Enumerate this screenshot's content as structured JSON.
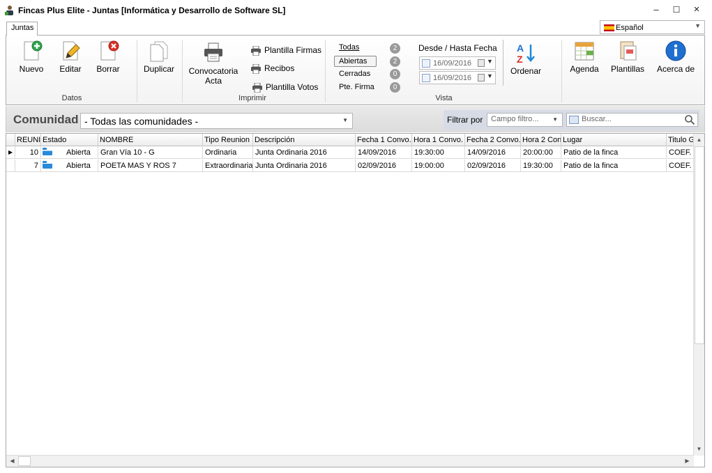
{
  "window": {
    "title": "Fincas Plus Elite - Juntas [Informática y Desarrollo de Software SL]"
  },
  "tab": {
    "label": "Juntas"
  },
  "language": {
    "value": "Español"
  },
  "ribbon": {
    "datos": {
      "label": "Datos",
      "nuevo": "Nuevo",
      "editar": "Editar",
      "borrar": "Borrar"
    },
    "duplicar": "Duplicar",
    "imprimir": {
      "label": "Imprimir",
      "convocatoria_line1": "Convocatoria",
      "convocatoria_line2": "Acta",
      "plantilla_firmas": "Plantilla Firmas",
      "recibos": "Recibos",
      "plantilla_votos": "Plantilla Votos"
    },
    "vista": {
      "label": "Vista",
      "todas": "Todas",
      "todas_count": "2",
      "abiertas": "Abiertas",
      "abiertas_count": "2",
      "cerradas": "Cerradas",
      "cerradas_count": "0",
      "pte_firma": "Pte. Firma",
      "pte_firma_count": "0",
      "fecha_label": "Desde / Hasta Fecha",
      "desde": "16/09/2016",
      "hasta": "16/09/2016"
    },
    "ordenar": "Ordenar",
    "agenda": "Agenda",
    "plantillas": "Plantillas",
    "acerca": "Acerca de"
  },
  "comunidad": {
    "label": "Comunidad",
    "selected": "- Todas las comunidades -"
  },
  "filter": {
    "label": "Filtrar por",
    "campo_placeholder": "Campo filtro...",
    "search_placeholder": "Buscar..."
  },
  "table": {
    "columns": [
      "REUNIO",
      "Estado",
      "NOMBRE",
      "Tipo Reunion",
      "Descripción",
      "Fecha 1 Convo.",
      "Hora 1 Convo.",
      "Fecha 2 Convo.",
      "Hora 2 Con",
      "Lugar",
      "Titulo G"
    ],
    "rows": [
      [
        "10",
        "Abierta",
        "Gran Vía 10 - G",
        "Ordinaria",
        "Junta Ordinaria 2016",
        "14/09/2016",
        "19:30:00",
        "14/09/2016",
        "20:00:00",
        "Patio de la finca",
        "COEF. I"
      ],
      [
        "7",
        "Abierta",
        "POETA MAS Y ROS 7",
        "Extraordinaria",
        "Junta Ordinaria 2016",
        "02/09/2016",
        "19:00:00",
        "02/09/2016",
        "19:30:00",
        "Patio de la finca",
        "COEF. I"
      ]
    ]
  },
  "colors": {
    "accent": "#2a8ad8",
    "grid_border": "#a9a9a9"
  }
}
